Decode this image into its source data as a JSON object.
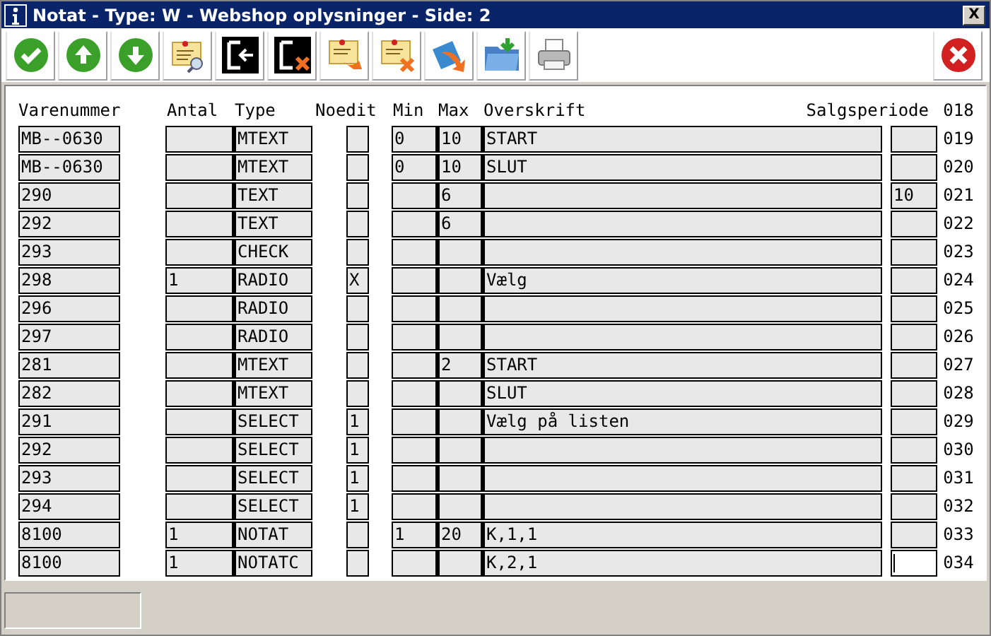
{
  "window": {
    "title": "Notat - Type: W - Webshop oplysninger - Side: 2",
    "close_label": "X"
  },
  "toolbar": {
    "buttons": [
      {
        "kind": "ok"
      },
      {
        "kind": "up"
      },
      {
        "kind": "down"
      },
      {
        "kind": "note-search"
      },
      {
        "kind": "exit"
      },
      {
        "kind": "exit-x"
      },
      {
        "kind": "note-arrow"
      },
      {
        "kind": "note-x"
      },
      {
        "kind": "swoosh"
      },
      {
        "kind": "folder"
      },
      {
        "kind": "printer"
      }
    ],
    "cancel": {
      "kind": "cancel"
    }
  },
  "table": {
    "columns": [
      "Varenummer",
      "Antal",
      "Type",
      "Noedit",
      "Min",
      "Max",
      "Overskrift",
      "Salgsperiode"
    ],
    "header_number": "018",
    "rows": [
      {
        "varenummer": "MB--0630",
        "antal": "",
        "type": "MTEXT",
        "noedit": "",
        "min": "0",
        "max": "10",
        "overskrift": "START",
        "salgsperiode": "",
        "number": "019",
        "focused": false
      },
      {
        "varenummer": "MB--0630",
        "antal": "",
        "type": "MTEXT",
        "noedit": "",
        "min": "0",
        "max": "10",
        "overskrift": "SLUT",
        "salgsperiode": "",
        "number": "020",
        "focused": false
      },
      {
        "varenummer": "290",
        "antal": "",
        "type": "TEXT",
        "noedit": "",
        "min": "",
        "max": "6",
        "overskrift": "",
        "salgsperiode": "10",
        "number": "021",
        "focused": false
      },
      {
        "varenummer": "292",
        "antal": "",
        "type": "TEXT",
        "noedit": "",
        "min": "",
        "max": "6",
        "overskrift": "",
        "salgsperiode": "",
        "number": "022",
        "focused": false
      },
      {
        "varenummer": "293",
        "antal": "",
        "type": "CHECK",
        "noedit": "",
        "min": "",
        "max": "",
        "overskrift": "",
        "salgsperiode": "",
        "number": "023",
        "focused": false
      },
      {
        "varenummer": "298",
        "antal": "1",
        "type": "RADIO",
        "noedit": "X",
        "min": "",
        "max": "",
        "overskrift": "Vælg",
        "salgsperiode": "",
        "number": "024",
        "focused": false
      },
      {
        "varenummer": "296",
        "antal": "",
        "type": "RADIO",
        "noedit": "",
        "min": "",
        "max": "",
        "overskrift": "",
        "salgsperiode": "",
        "number": "025",
        "focused": false
      },
      {
        "varenummer": "297",
        "antal": "",
        "type": "RADIO",
        "noedit": "",
        "min": "",
        "max": "",
        "overskrift": "",
        "salgsperiode": "",
        "number": "026",
        "focused": false
      },
      {
        "varenummer": "281",
        "antal": "",
        "type": "MTEXT",
        "noedit": "",
        "min": "",
        "max": "2",
        "overskrift": "START",
        "salgsperiode": "",
        "number": "027",
        "focused": false
      },
      {
        "varenummer": "282",
        "antal": "",
        "type": "MTEXT",
        "noedit": "",
        "min": "",
        "max": "",
        "overskrift": "SLUT",
        "salgsperiode": "",
        "number": "028",
        "focused": false
      },
      {
        "varenummer": "291",
        "antal": "",
        "type": "SELECT",
        "noedit": "1",
        "min": "",
        "max": "",
        "overskrift": "Vælg på listen",
        "salgsperiode": "",
        "number": "029",
        "focused": false
      },
      {
        "varenummer": "292",
        "antal": "",
        "type": "SELECT",
        "noedit": "1",
        "min": "",
        "max": "",
        "overskrift": "",
        "salgsperiode": "",
        "number": "030",
        "focused": false
      },
      {
        "varenummer": "293",
        "antal": "",
        "type": "SELECT",
        "noedit": "1",
        "min": "",
        "max": "",
        "overskrift": "",
        "salgsperiode": "",
        "number": "031",
        "focused": false
      },
      {
        "varenummer": "294",
        "antal": "",
        "type": "SELECT",
        "noedit": "1",
        "min": "",
        "max": "",
        "overskrift": "",
        "salgsperiode": "",
        "number": "032",
        "focused": false
      },
      {
        "varenummer": "8100",
        "antal": "1",
        "type": "NOTAT",
        "noedit": "",
        "min": "1",
        "max": "20",
        "overskrift": "K,1,1",
        "salgsperiode": "",
        "number": "033",
        "focused": false
      },
      {
        "varenummer": "8100",
        "antal": "1",
        "type": "NOTATC",
        "noedit": "",
        "min": "",
        "max": "",
        "overskrift": "K,2,1",
        "salgsperiode": "",
        "number": "034",
        "focused": true
      }
    ]
  }
}
